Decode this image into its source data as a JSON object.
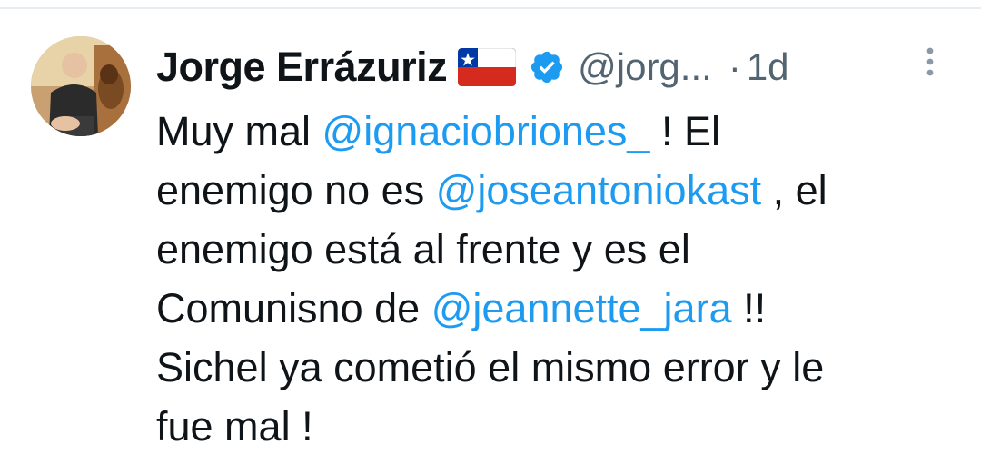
{
  "author": {
    "display_name": "Jorge Errázuriz",
    "handle": "@jorg...",
    "separator": "·",
    "time": "1d",
    "flag_icon": "chile-flag-icon",
    "verified_icon": "verified-badge-icon",
    "verified_color": "#1d9bf0"
  },
  "tweet": {
    "lines": [
      {
        "t1": "Muy mal ",
        "m1": "@ignaciobriones_",
        "t2": " ! El"
      },
      {
        "t1": "enemigo no es ",
        "m1": "@joseantonio​kast",
        "t2": " , el"
      },
      {
        "t1": "enemigo está al frente y es el"
      },
      {
        "t1": "Comunisno de ",
        "m1": "@jeannette_jara",
        "t2": "  !!"
      },
      {
        "t1": "Sichel ya cometió el mismo error y le"
      },
      {
        "t1": "fue mal !"
      }
    ]
  },
  "colors": {
    "text": "#0f1419",
    "secondary": "#536471",
    "mention": "#1d9bf0"
  }
}
